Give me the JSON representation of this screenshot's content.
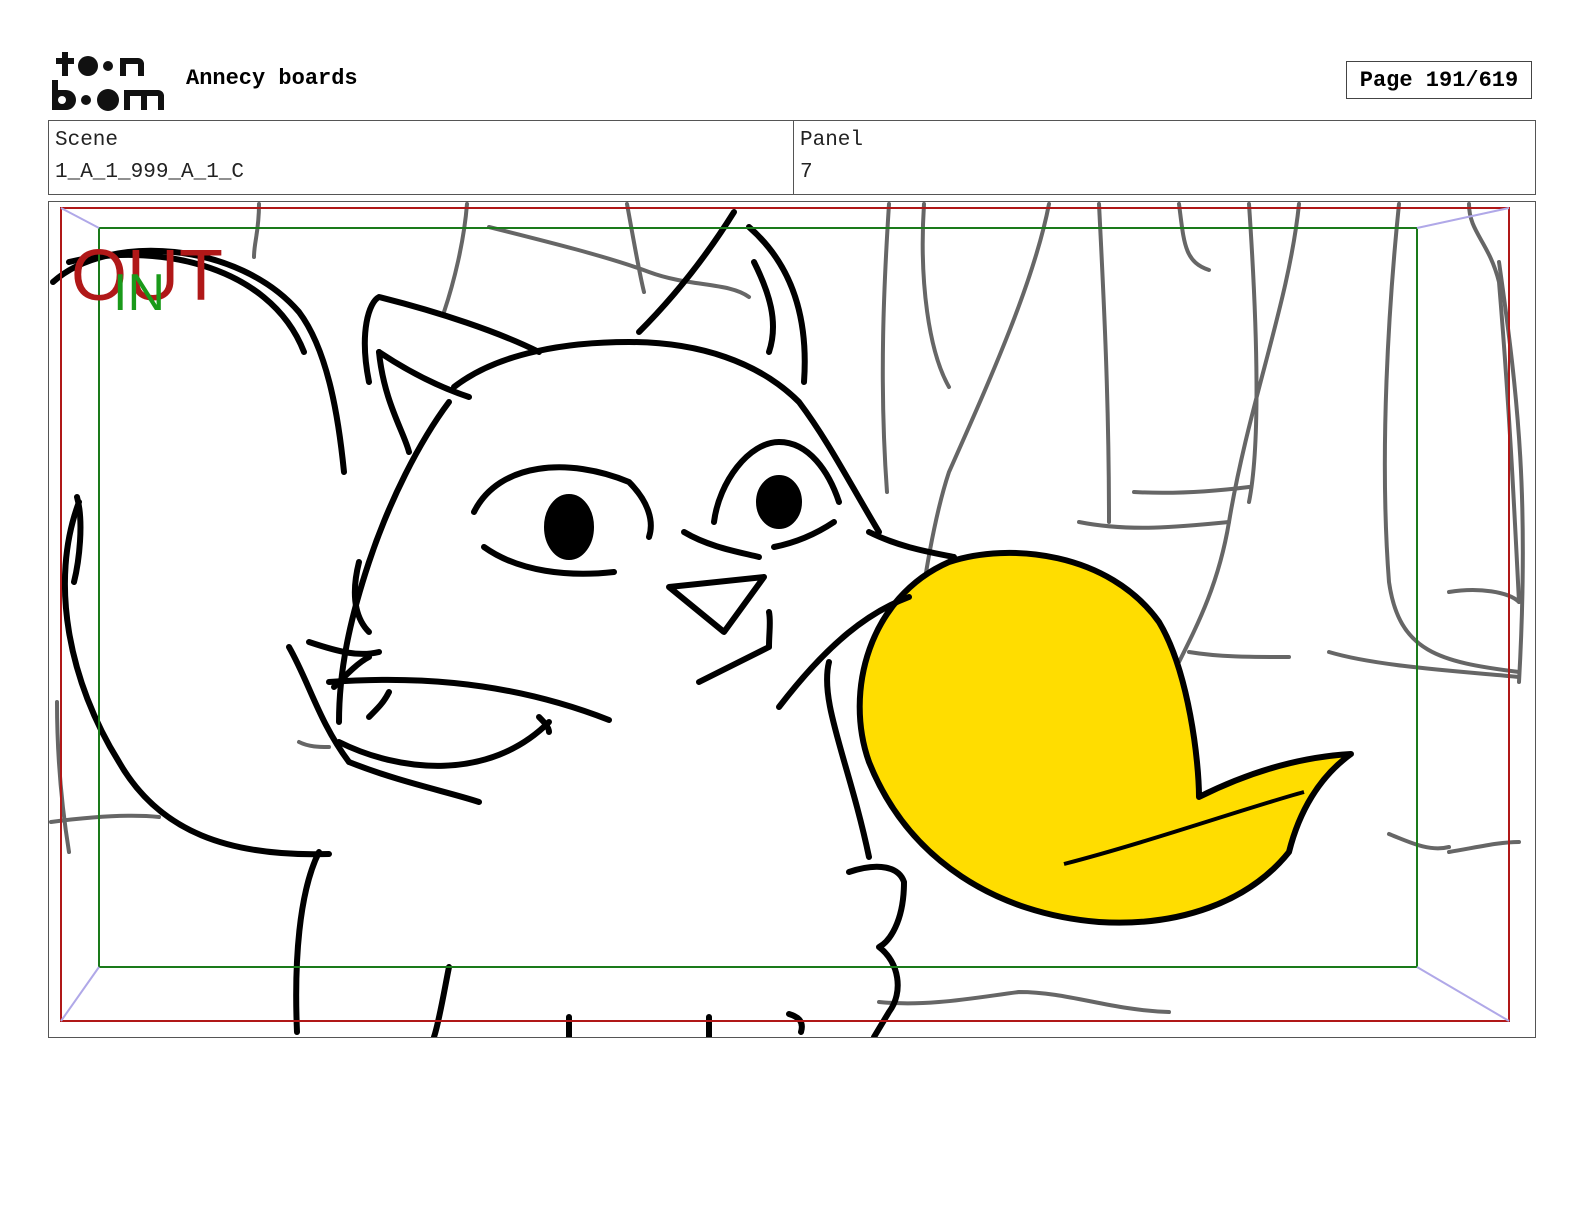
{
  "header": {
    "logo_text": "toon boom",
    "title": "Annecy boards",
    "page_label": "Page 191/619"
  },
  "info": {
    "scene_label": "Scene",
    "scene_value": "1_A_1_999_A_1_C",
    "panel_label": "Panel",
    "panel_value": "7"
  },
  "frame_guides": {
    "out_label": "OUT",
    "in_label": "IN",
    "out_color": "#b01818",
    "in_color": "#1a9a1a"
  },
  "colors": {
    "speech_bubble": "#ffdd00",
    "sketch_line": "#000000",
    "background_line": "#666666"
  }
}
